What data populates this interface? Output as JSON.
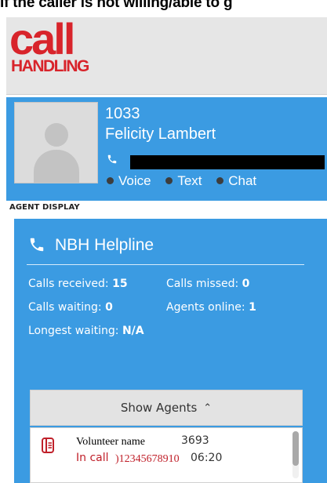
{
  "caption": "If the caller is not willing/able to g",
  "logo": {
    "line1": "call",
    "line2": "HANDLING"
  },
  "agent": {
    "extension": "1033",
    "name": "Felicity Lambert",
    "channels": [
      "Voice",
      "Text",
      "Chat"
    ]
  },
  "section_label": "AGENT DISPLAY",
  "helpline": {
    "title": "NBH Helpline",
    "stats": {
      "calls_received_label": "Calls received:",
      "calls_received_value": "15",
      "calls_missed_label": "Calls missed:",
      "calls_missed_value": "0",
      "calls_waiting_label": "Calls waiting:",
      "calls_waiting_value": "0",
      "agents_online_label": "Agents online:",
      "agents_online_value": "1",
      "longest_waiting_label": "Longest waiting:",
      "longest_waiting_value": "N/A"
    }
  },
  "show_agents_label": "Show Agents",
  "agent_list": [
    {
      "name": "Volunteer name",
      "ext": "3693",
      "status": "In call",
      "number": ")12345678910",
      "duration": "06:20"
    }
  ],
  "colors": {
    "brand_red": "#d8242b",
    "panel_blue": "#3b9be2",
    "incall_red": "#c0202a"
  },
  "icons": {
    "phone": "phone-icon",
    "caret": "chevron-up-icon",
    "agent_row": "agent-status-icon"
  }
}
